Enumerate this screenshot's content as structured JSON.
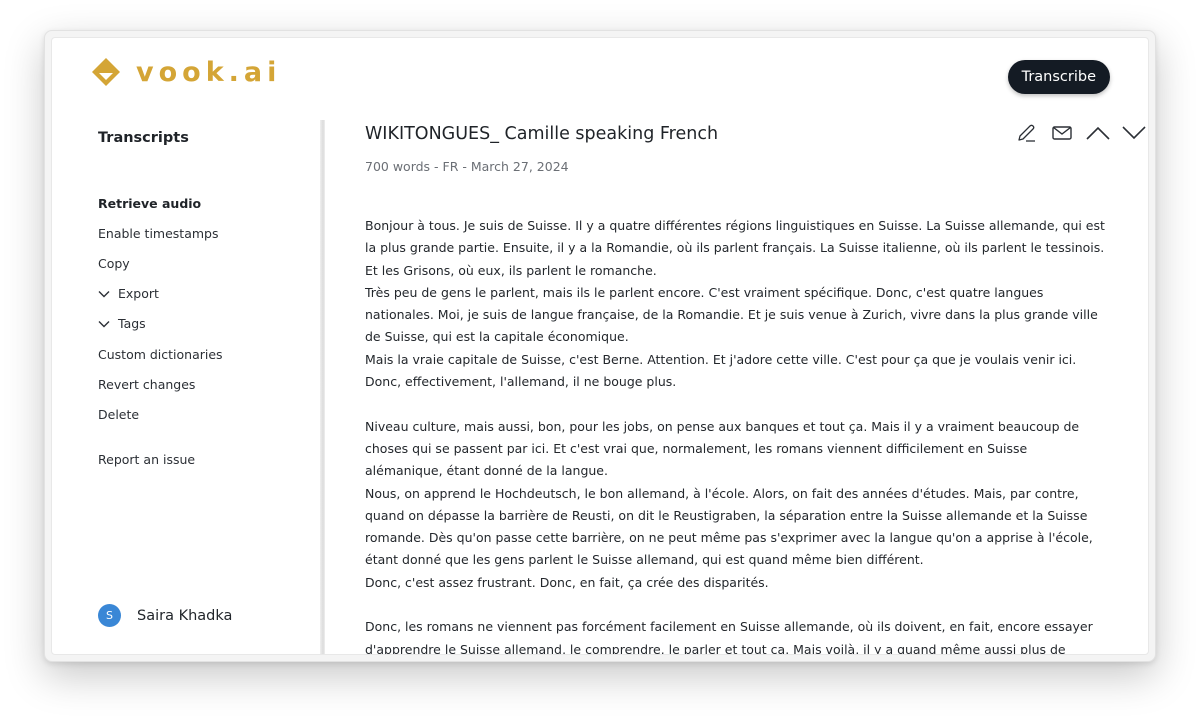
{
  "app": {
    "logo_text": "vook.ai",
    "brand_color": "#d4a536"
  },
  "header": {
    "transcribe_label": "Transcribe"
  },
  "sidebar": {
    "title": "Transcripts",
    "items": [
      {
        "label": "Retrieve audio",
        "bold": true
      },
      {
        "label": "Enable timestamps"
      },
      {
        "label": "Copy"
      },
      {
        "label": "Export",
        "expandable": true
      },
      {
        "label": "Tags",
        "expandable": true
      },
      {
        "label": "Custom dictionaries"
      },
      {
        "label": "Revert changes"
      },
      {
        "label": "Delete"
      }
    ],
    "report_label": "Report an issue",
    "user": {
      "initial": "S",
      "name": "Saira Khadka",
      "avatar_color": "#3a87d6"
    }
  },
  "document": {
    "title": "WIKITONGUES_ Camille speaking French",
    "meta": "700 words - FR - March 27, 2024",
    "toolbar": [
      {
        "icon": "pencil-icon",
        "label": "Edit"
      },
      {
        "icon": "mail-icon",
        "label": "Email"
      },
      {
        "icon": "chevron-up-icon",
        "label": "Previous"
      },
      {
        "icon": "chevron-down-icon",
        "label": "Next"
      }
    ],
    "paragraphs": [
      [
        "Bonjour à tous. Je suis de Suisse. Il y a quatre différentes régions linguistiques en Suisse. La Suisse allemande, qui est la plus grande partie. Ensuite, il y a la Romandie, où ils parlent français. La Suisse italienne, où ils parlent le tessinois. Et les Grisons, où eux, ils parlent le romanche.",
        "Très peu de gens le parlent, mais ils le parlent encore. C'est vraiment spécifique. Donc, c'est quatre langues nationales. Moi, je suis de langue française, de la Romandie. Et je suis venue à Zurich, vivre dans la plus grande ville de Suisse, qui est la capitale économique.",
        "Mais la vraie capitale de Suisse, c'est Berne. Attention. Et j'adore cette ville. C'est pour ça que je voulais venir ici. Donc, effectivement, l'allemand, il ne bouge plus."
      ],
      [
        "Niveau culture, mais aussi, bon, pour les jobs, on pense aux banques et tout ça. Mais il y a vraiment beaucoup de choses qui se passent par ici. Et c'est vrai que, normalement, les romans viennent difficilement en Suisse alémanique, étant donné de la langue.",
        "Nous, on apprend le Hochdeutsch, le bon allemand, à l'école. Alors, on fait des années d'études. Mais, par contre, quand on dépasse la barrière de Reusti, on dit le Reustigraben, la séparation entre la Suisse allemande et la Suisse romande. Dès qu'on passe cette barrière, on ne peut même pas s'exprimer avec la langue qu'on a apprise à l'école, étant donné que les gens parlent le Suisse allemand, qui est quand même bien différent.",
        "Donc, c'est assez frustrant. Donc, en fait, ça crée des disparités."
      ],
      [
        "Donc, les romans ne viennent pas forcément facilement en Suisse allemande, où ils doivent, en fait, encore essayer d'apprendre le Suisse allemand, le comprendre, le parler et tout ça. Mais voilà, il y a quand même aussi plus de boulot"
      ]
    ]
  }
}
